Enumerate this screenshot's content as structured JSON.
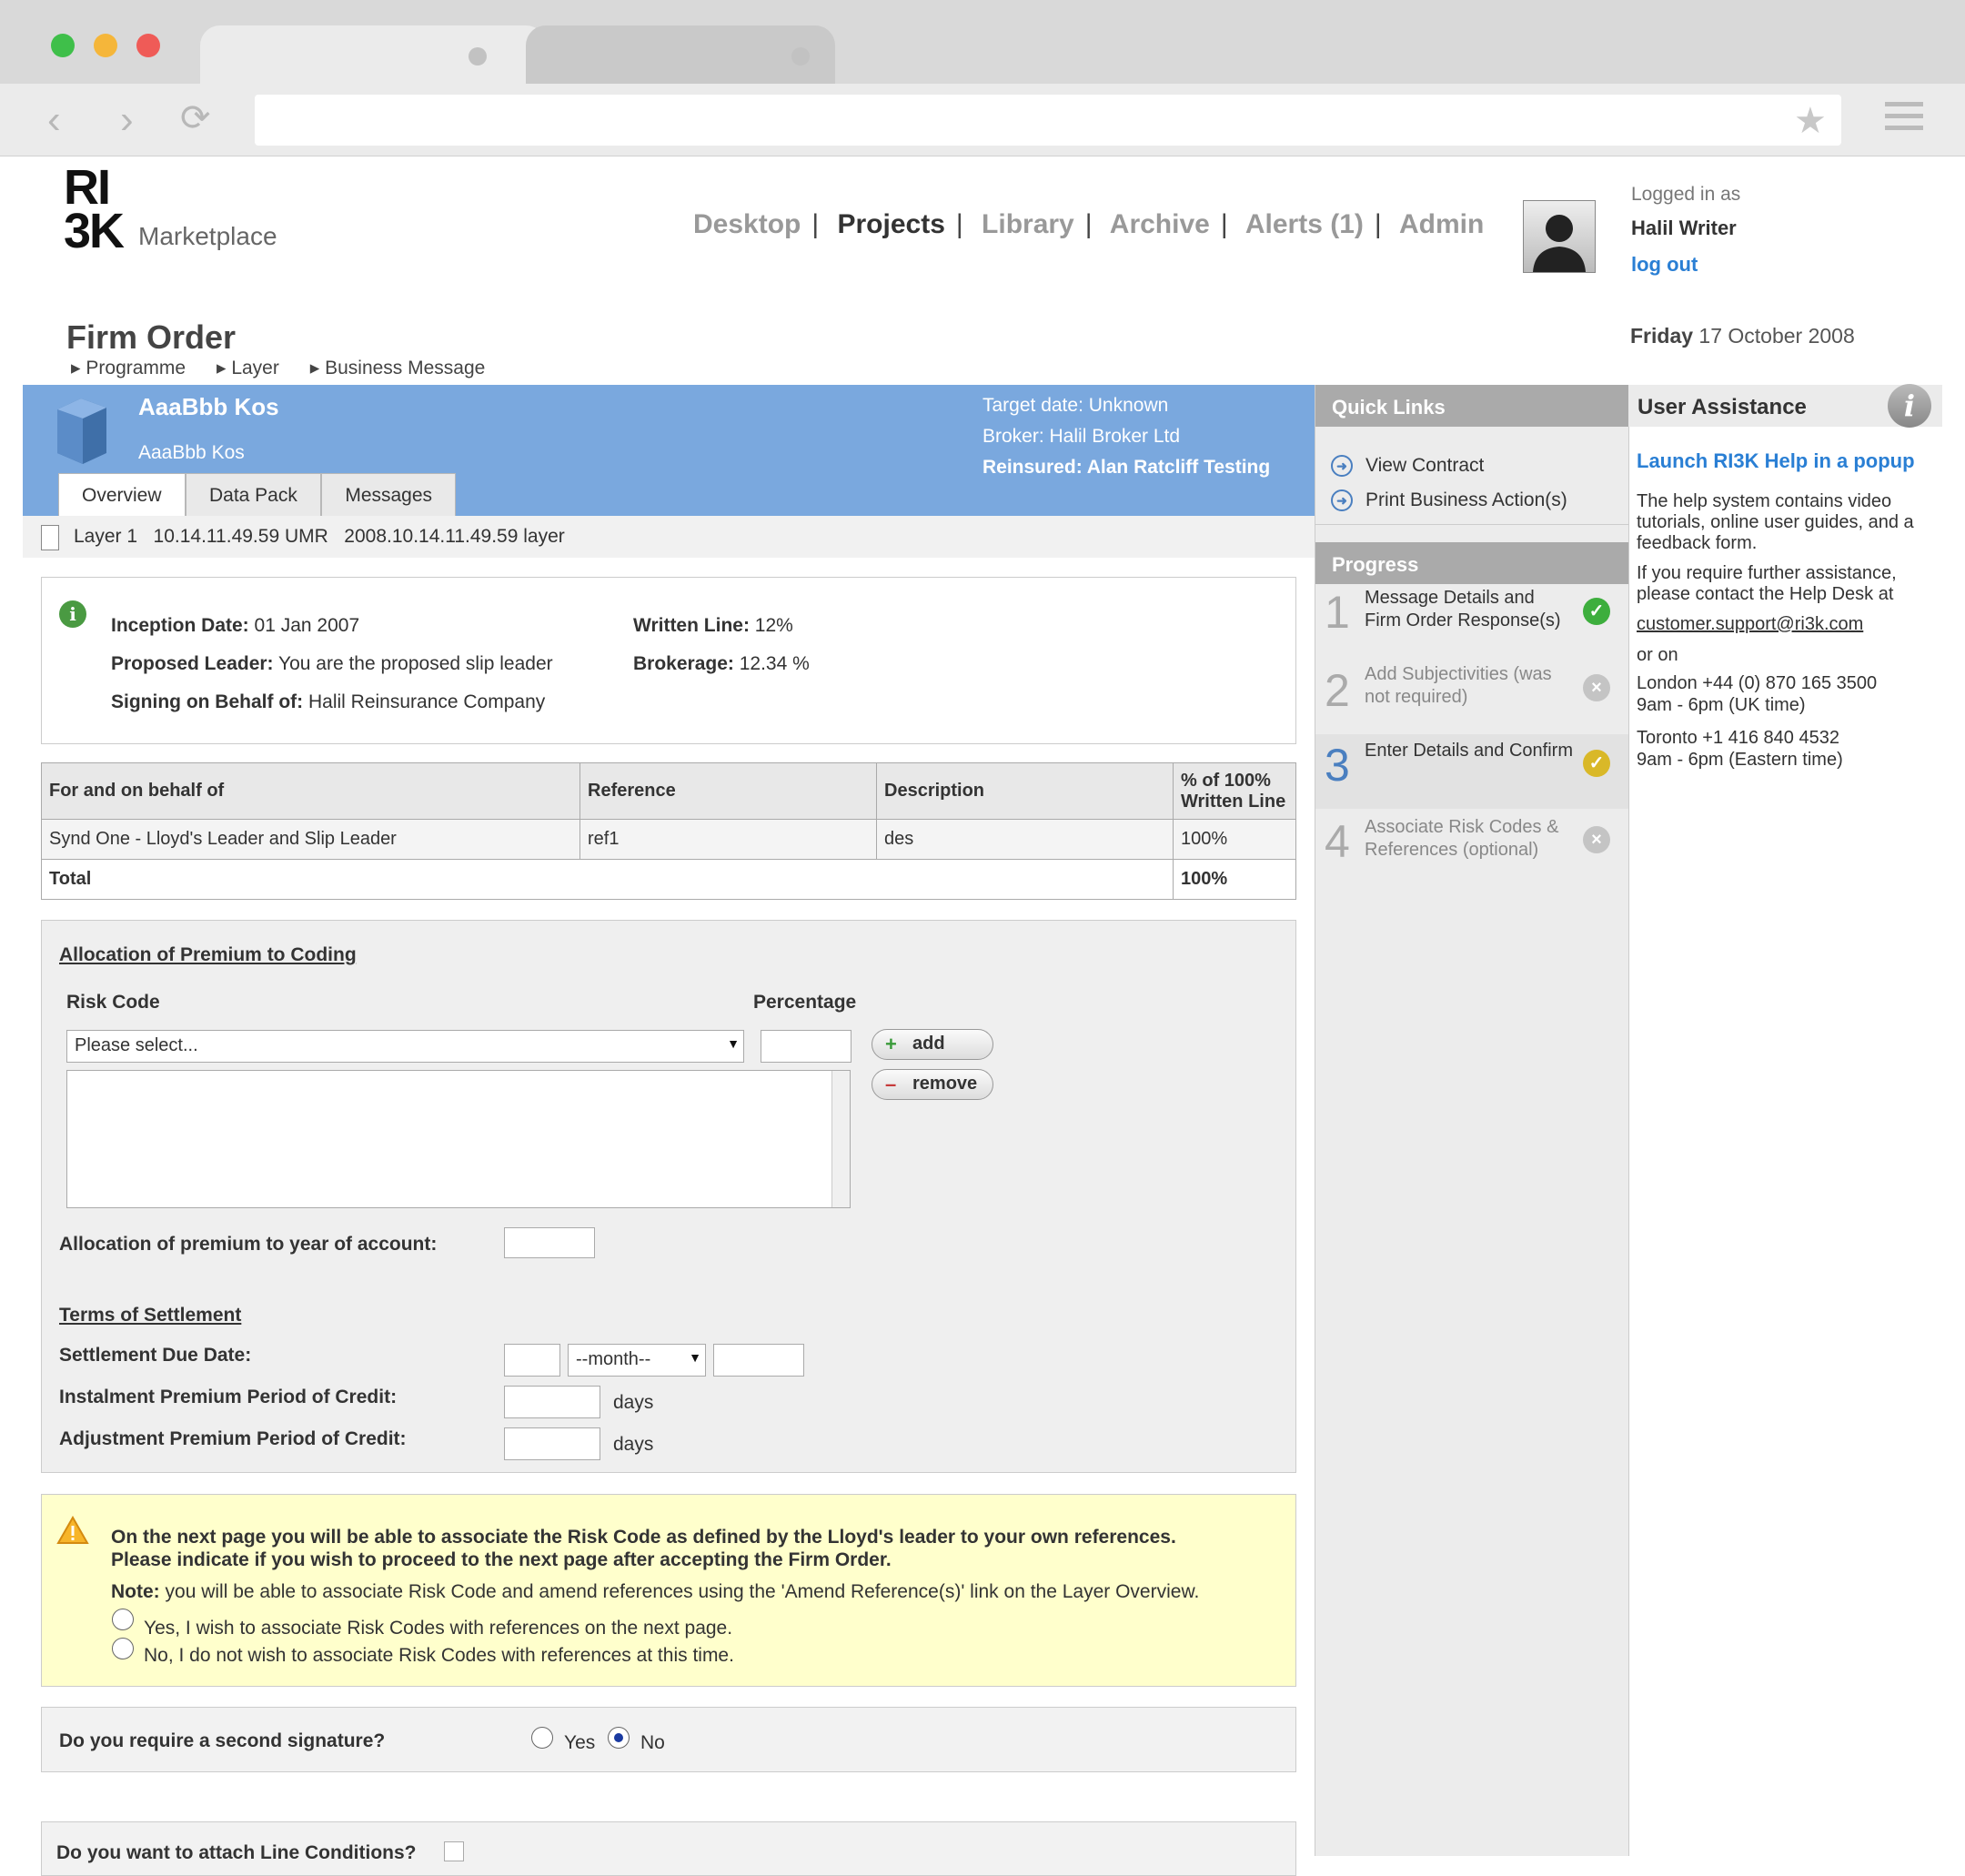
{
  "colors": {
    "accent_blue": "#7aa8de",
    "link_blue": "#2a7fd4",
    "warning_bg": "#ffffcc",
    "status_green": "#3dae3d",
    "status_yellow": "#d9b828",
    "status_grey": "#c4c4c4"
  },
  "header": {
    "logo_ri3k": "RI\n3K",
    "logo_sub": "Marketplace",
    "nav": [
      "Desktop",
      "Projects",
      "Library",
      "Archive",
      "Alerts (1)",
      "Admin"
    ],
    "nav_active": "Projects",
    "login_label": "Logged in as",
    "user": "Halil Writer",
    "logout": "log out"
  },
  "page": {
    "title": "Firm Order",
    "date_day": "Friday",
    "date_rest": "17 October 2008",
    "breadcrumb": [
      "Programme",
      "Layer",
      "Business Message"
    ]
  },
  "project": {
    "title": "AaaBbb Kos",
    "subtitle": "AaaBbb Kos",
    "target_date": "Target date: Unknown",
    "broker": "Broker: Halil Broker Ltd",
    "reinsured": "Reinsured: Alan Ratcliff Testing",
    "tabs": [
      "Overview",
      "Data Pack",
      "Messages"
    ],
    "layer_line": "Layer 1   10.14.11.49.59 UMR   2008.10.14.11.49.59 layer"
  },
  "info": {
    "inception_label": "Inception Date:",
    "inception": "01 Jan 2007",
    "leader_label": "Proposed Leader:",
    "leader": "You are the proposed slip leader",
    "signing_label": "Signing on Behalf of:",
    "signing": "Halil Reinsurance Company",
    "written_label": "Written Line:",
    "written": "12%",
    "brokerage_label": "Brokerage:",
    "brokerage": "12.34 %"
  },
  "table": {
    "headers": [
      "For and on behalf of",
      "Reference",
      "Description",
      "% of 100% Written Line"
    ],
    "rows": [
      [
        "Synd One - Lloyd's Leader and Slip Leader",
        "ref1",
        "des",
        "100%"
      ]
    ],
    "total_label": "Total",
    "total_value": "100%"
  },
  "allocation": {
    "title": "Allocation of Premium to Coding",
    "risk_code_label": "Risk Code",
    "percentage_label": "Percentage",
    "select_placeholder": "Please select...",
    "add": "add",
    "remove": "remove",
    "year_label": "Allocation of premium to year of account:",
    "terms_title": "Terms of Settlement",
    "due_label": "Settlement Due Date:",
    "month_placeholder": "--month--",
    "instalment_label": "Instalment Premium Period of Credit:",
    "adjustment_label": "Adjustment Premium Period of Credit:",
    "days": "days"
  },
  "warning": {
    "line1": "On the next page you will be able to associate the Risk Code as defined by the Lloyd's leader to your own references.",
    "line2": "Please indicate if you wish to proceed to the next page after accepting the Firm Order.",
    "note_label": "Note:",
    "note": "you will be able to associate Risk Code and amend references using the 'Amend Reference(s)' link on the Layer Overview.",
    "opt_yes": "Yes, I wish to associate Risk Codes with references on the next page.",
    "opt_no": "No, I do not wish to associate Risk Codes with references at this time."
  },
  "signature": {
    "question": "Do you require a second signature?",
    "yes": "Yes",
    "no": "No",
    "selected": "No"
  },
  "line_conditions": {
    "question": "Do you want to attach Line Conditions?"
  },
  "quick_links": {
    "title": "Quick Links",
    "items": [
      "View Contract",
      "Print Business Action(s)"
    ]
  },
  "progress": {
    "title": "Progress",
    "steps": [
      {
        "num": "1",
        "label": "Message Details and Firm Order Response(s)",
        "status": "done"
      },
      {
        "num": "2",
        "label": "Add Subjectivities (was not required)",
        "status": "skipped"
      },
      {
        "num": "3",
        "label": "Enter Details and Confirm",
        "status": "current"
      },
      {
        "num": "4",
        "label": "Associate Risk Codes & References (optional)",
        "status": "pending"
      }
    ]
  },
  "assistance": {
    "title": "User Assistance",
    "link": "Launch RI3K Help in a popup",
    "p1": "The help system contains video tutorials, online user guides, and a feedback form.",
    "p2": "If you require further assistance, please contact the Help Desk at",
    "email": "customer.support@ri3k.com",
    "or_on": "or on",
    "london": "London +44 (0) 870 165 3500",
    "london_hours": "9am - 6pm (UK time)",
    "toronto": "Toronto +1 416 840 4532",
    "toronto_hours": "9am - 6pm (Eastern time)"
  }
}
